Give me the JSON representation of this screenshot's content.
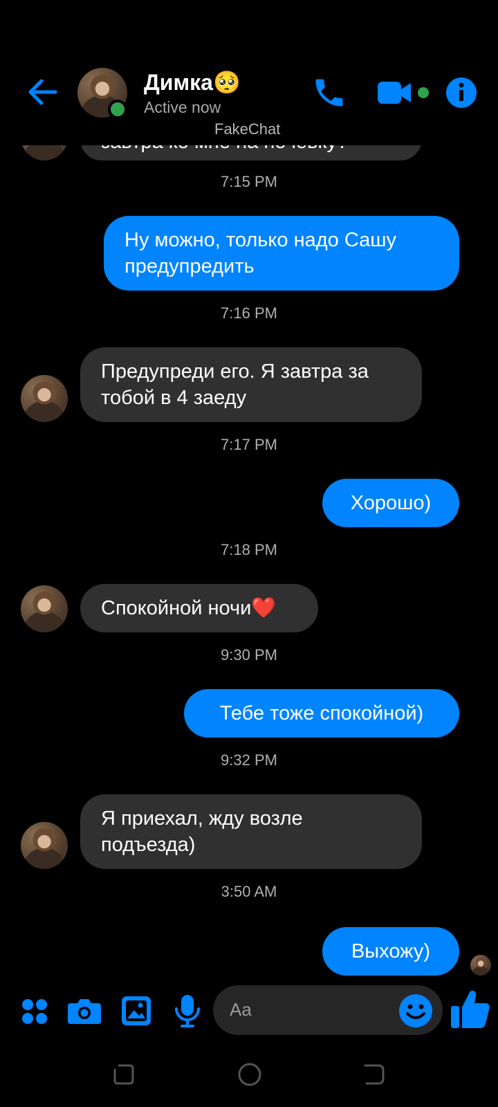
{
  "header": {
    "contact_name": "Димка🥺",
    "status": "Active now",
    "watermark": "FakeChat"
  },
  "messages": [
    {
      "text": "завтра ко мне на ночевку?"
    },
    {
      "time": "7:15 PM"
    },
    {
      "text": "Ну можно, только надо Сашу предупредить"
    },
    {
      "time": "7:16 PM"
    },
    {
      "text": "Предупреди его. Я завтра за тобой в 4 заеду"
    },
    {
      "time": "7:17 PM"
    },
    {
      "text": "Хорошо)"
    },
    {
      "time": "7:18 PM"
    },
    {
      "text": "Спокойной ночи❤️"
    },
    {
      "time": "9:30 PM"
    },
    {
      "text": "Тебе тоже спокойной)"
    },
    {
      "time": "9:32 PM"
    },
    {
      "text": "Я приехал, жду возле подъезда)"
    },
    {
      "time": "3:50 AM"
    },
    {
      "text": "Выхожу)"
    }
  ],
  "composer": {
    "placeholder": "Aa"
  },
  "colors": {
    "accent": "#0084ff",
    "incoming_bubble": "#303030",
    "online": "#31a24c"
  },
  "icons": [
    "back-arrow-icon",
    "phone-icon",
    "video-camera-icon",
    "info-icon",
    "apps-icon",
    "camera-icon",
    "gallery-icon",
    "microphone-icon",
    "emoji-icon",
    "thumbs-up-icon"
  ]
}
